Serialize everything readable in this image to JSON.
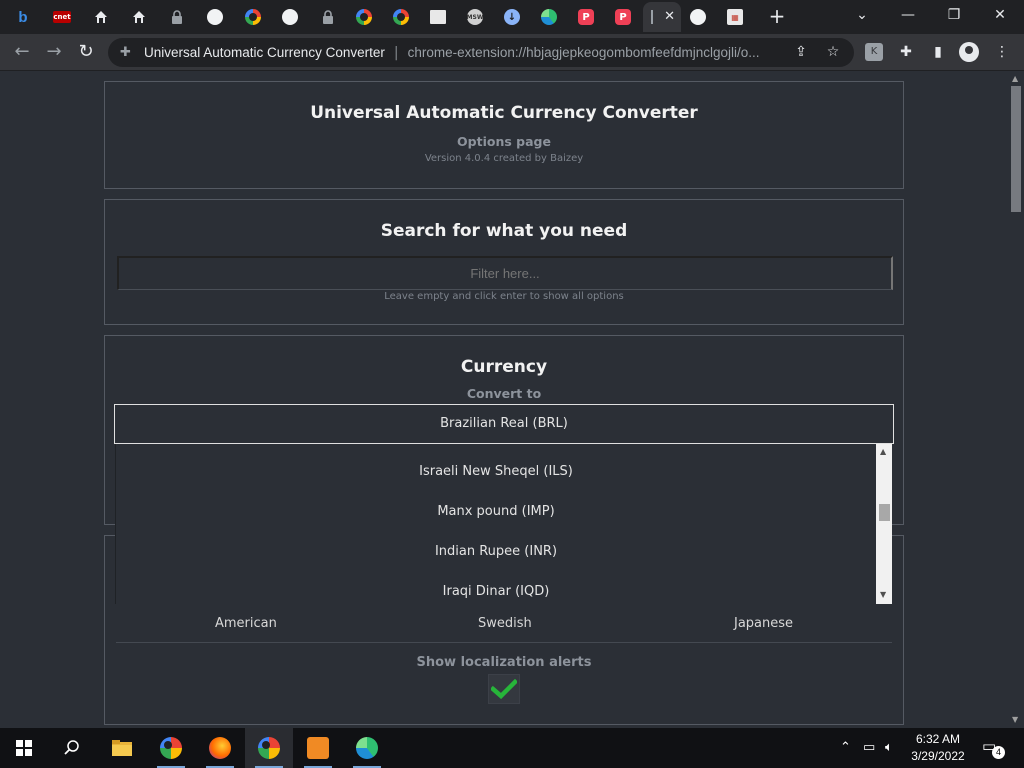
{
  "browser": {
    "tabs": [
      {
        "icon": "bing-icon",
        "glyph": "b"
      },
      {
        "icon": "cnet-icon",
        "glyph": "cnet"
      },
      {
        "icon": "house-icon",
        "glyph": ""
      },
      {
        "icon": "house-icon",
        "glyph": ""
      },
      {
        "icon": "lock-icon",
        "glyph": ""
      },
      {
        "icon": "globe-icon",
        "glyph": ""
      },
      {
        "icon": "google-icon",
        "glyph": ""
      },
      {
        "icon": "globe-icon",
        "glyph": ""
      },
      {
        "icon": "lock-icon",
        "glyph": ""
      },
      {
        "icon": "google-icon",
        "glyph": ""
      },
      {
        "icon": "google-icon",
        "glyph": ""
      },
      {
        "icon": "thumbnail-icon",
        "glyph": ""
      },
      {
        "icon": "msw-icon",
        "glyph": "MSW"
      },
      {
        "icon": "download-icon",
        "glyph": "↓"
      },
      {
        "icon": "edge-icon",
        "glyph": ""
      },
      {
        "icon": "pocket-icon",
        "glyph": "P"
      },
      {
        "icon": "pocket-icon",
        "glyph": "P"
      },
      {
        "icon": "extension-tab-icon",
        "glyph": "",
        "active": true
      },
      {
        "icon": "globe-icon",
        "glyph": ""
      },
      {
        "icon": "calendar-icon",
        "glyph": "▦"
      }
    ],
    "omnibox": {
      "site_name": "Universal Automatic Currency Converter",
      "url": "chrome-extension://hbjagjepkeogombomfeefdmjnclgojli/o..."
    }
  },
  "page": {
    "header": {
      "title": "Universal Automatic Currency Converter",
      "subtitle": "Options page",
      "version": "Version 4.0.4 created by Baizey"
    },
    "search": {
      "title": "Search for what you need",
      "placeholder": "Filter here...",
      "hint": "Leave empty and click enter to show all options"
    },
    "currency": {
      "title": "Currency",
      "convert_to_label": "Convert to",
      "selected": "Brazilian Real (BRL)",
      "options": [
        "Israeli New Sheqel (ILS)",
        "Manx pound (IMP)",
        "Indian Rupee (INR)",
        "Iraqi Dinar (IQD)"
      ]
    },
    "formatting": {
      "options": [
        "American",
        "Swedish",
        "Japanese"
      ],
      "localization_label": "Show localization alerts",
      "localization_enabled": true
    }
  },
  "taskbar": {
    "time": "6:32 AM",
    "date": "3/29/2022",
    "notification_count": "4",
    "apps": [
      "file-explorer-icon",
      "chrome-icon",
      "firefox-icon",
      "chrome-profile-icon",
      "pocket-app-icon",
      "edge-icon"
    ]
  }
}
